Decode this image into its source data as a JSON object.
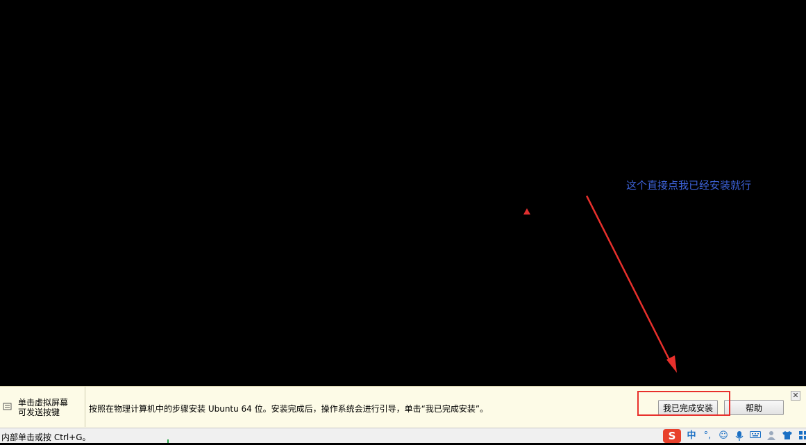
{
  "annotation": {
    "text": "这个直接点我已经安装就行",
    "color": "#3d62d8"
  },
  "hint_bar": {
    "left_text_line1": "单击虚拟屏幕",
    "left_text_line2": "可发送按键",
    "message": "按照在物理计算机中的步骤安装 Ubuntu 64 位。安装完成后，操作系统会进行引导，单击“我已完成安装”。",
    "done_button": "我已完成安装",
    "help_button": "帮助",
    "close_glyph": "✕"
  },
  "status_bar": {
    "text": "内部单击或按 Ctrl+G。"
  },
  "tray": {
    "sogou": "S",
    "ime_mode": "中",
    "punct": "°,",
    "icons": [
      "smiley-icon",
      "microphone-icon",
      "keyboard-icon",
      "user-icon",
      "shirt-icon",
      "grid-icon"
    ]
  },
  "colors": {
    "arrow": "#e8302c",
    "highlight": "#e8302c",
    "hint_bg": "#fdfbe7"
  }
}
